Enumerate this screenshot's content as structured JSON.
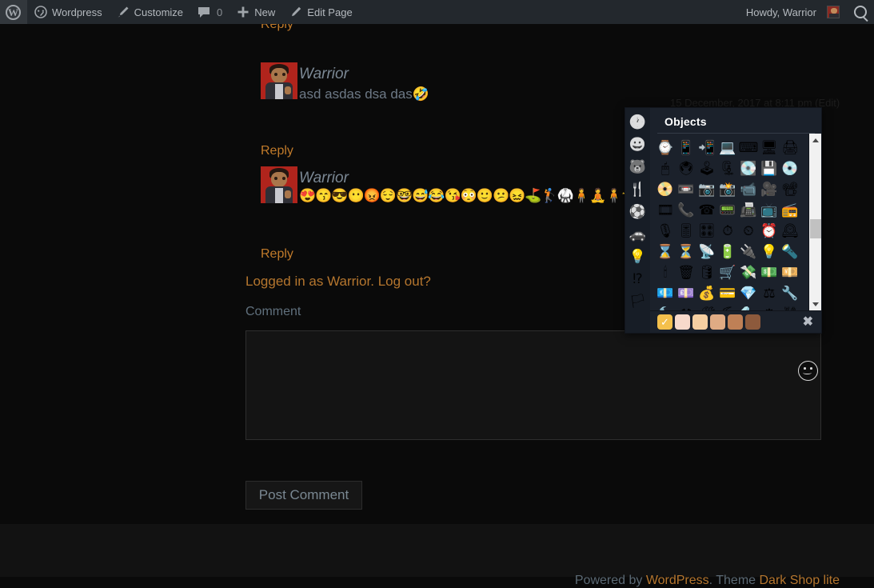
{
  "adminbar": {
    "logo_glyph": "W",
    "items": [
      {
        "name": "wordpress",
        "label": "Wordpress",
        "icon": "dashboard-icon",
        "glyph": "◴"
      },
      {
        "name": "customize",
        "label": "Customize",
        "icon": "paintbrush-icon",
        "glyph": "✎"
      },
      {
        "name": "comments",
        "label": "0",
        "icon": "comment-bubble-icon",
        "glyph": "🗨"
      },
      {
        "name": "new",
        "label": "New",
        "icon": "plus-icon",
        "glyph": "✚"
      },
      {
        "name": "edit-page",
        "label": "Edit Page",
        "icon": "pencil-icon",
        "glyph": "✏"
      }
    ],
    "howdy": "Howdy, Warrior",
    "search_icon": "search-icon"
  },
  "comments": {
    "top_partial_reply": "Reply",
    "list": [
      {
        "author": "Warrior",
        "meta_date": "15 December, 2017 at 8:11 pm",
        "meta_edit": "(Edit)",
        "text": "asd asdas dsa das",
        "trailing_emoji": "🤣",
        "reply_label": "Reply"
      },
      {
        "author": "Warrior",
        "meta_date": "",
        "meta_edit": "",
        "text": "",
        "emoji_run": "😍😙😎😶😡😌🤓😅😂😘😳🙂😕😖⛳🏌🥋🧍🧘🧍🤸",
        "reply_label": "Reply"
      }
    ]
  },
  "comment_form": {
    "logged_in_prefix": "Logged in as ",
    "logged_in_user": "Warrior",
    "logged_in_sep": ". ",
    "logout_label": "Log out?",
    "comment_label": "Comment",
    "textarea_value": "",
    "textarea_placeholder": "",
    "submit_label": "Post Comment",
    "emoji_toggle_icon": "smiley-face-icon"
  },
  "emoji_picker": {
    "title": "Objects",
    "title_icon": "clock-icon",
    "close_label": "✖",
    "categories": [
      {
        "name": "recent",
        "icon": "clock-icon",
        "glyph": "🕐",
        "active": false
      },
      {
        "name": "people",
        "icon": "smiley-icon",
        "glyph": "😀",
        "active": false
      },
      {
        "name": "nature",
        "icon": "bear-icon",
        "glyph": "🐻",
        "active": false
      },
      {
        "name": "food",
        "icon": "fork-knife-icon",
        "glyph": "🍴",
        "active": false
      },
      {
        "name": "activity",
        "icon": "soccer-ball-icon",
        "glyph": "⚽",
        "active": false
      },
      {
        "name": "travel",
        "icon": "car-icon",
        "glyph": "🚗",
        "active": false
      },
      {
        "name": "objects",
        "icon": "lightbulb-icon",
        "glyph": "💡",
        "active": true
      },
      {
        "name": "symbols",
        "icon": "exclamation-question-icon",
        "glyph": "⁉",
        "active": false
      },
      {
        "name": "flags",
        "icon": "flag-icon",
        "glyph": "🏳",
        "active": false
      }
    ],
    "emojis": [
      "⌚",
      "📱",
      "📲",
      "💻",
      "⌨",
      "🖥",
      "🖨",
      "🖱",
      "🖲",
      "🕹",
      "🗜",
      "💽",
      "💾",
      "💿",
      "📀",
      "📼",
      "📷",
      "📸",
      "📹",
      "🎥",
      "📽",
      "🎞",
      "📞",
      "☎",
      "📟",
      "📠",
      "📺",
      "📻",
      "🎙",
      "🎚",
      "🎛",
      "⏱",
      "⏲",
      "⏰",
      "🕰",
      "⌛",
      "⏳",
      "📡",
      "🔋",
      "🔌",
      "💡",
      "🔦",
      "🕯",
      "🗑",
      "🛢",
      "🛒",
      "💸",
      "💵",
      "💴",
      "💶",
      "💷",
      "💰",
      "💳",
      "💎",
      "⚖",
      "🔧",
      "🔨",
      "⚒",
      "🛠",
      "⛏",
      "🔩",
      "⚙",
      "⛓"
    ],
    "skin_tones": [
      {
        "name": "tone-default",
        "color": "#f4c04c",
        "selected": true
      },
      {
        "name": "tone-1",
        "color": "#f7d9cb",
        "selected": false
      },
      {
        "name": "tone-2",
        "color": "#f5cfa2",
        "selected": false
      },
      {
        "name": "tone-3",
        "color": "#dfab84",
        "selected": false
      },
      {
        "name": "tone-4",
        "color": "#bf8056",
        "selected": false
      },
      {
        "name": "tone-5",
        "color": "#8d5a3c",
        "selected": false
      }
    ],
    "selected_check": "✓",
    "scrollbar": {
      "up_arrow": "▲",
      "down_arrow": "▼",
      "thumb_position_pct": 55
    }
  },
  "footer": {
    "powered_prefix": "Powered by ",
    "wordpress_link": "WordPress",
    "theme_mid": ". Theme ",
    "theme_link": "Dark Shop lite"
  },
  "colors": {
    "adminbar_bg": "#23282d",
    "page_bg": "#0a0a0a",
    "footer_bg": "#121212",
    "link_orange": "#b5762e",
    "text_muted": "#6d7986",
    "picker_bg": "#1b212b"
  }
}
